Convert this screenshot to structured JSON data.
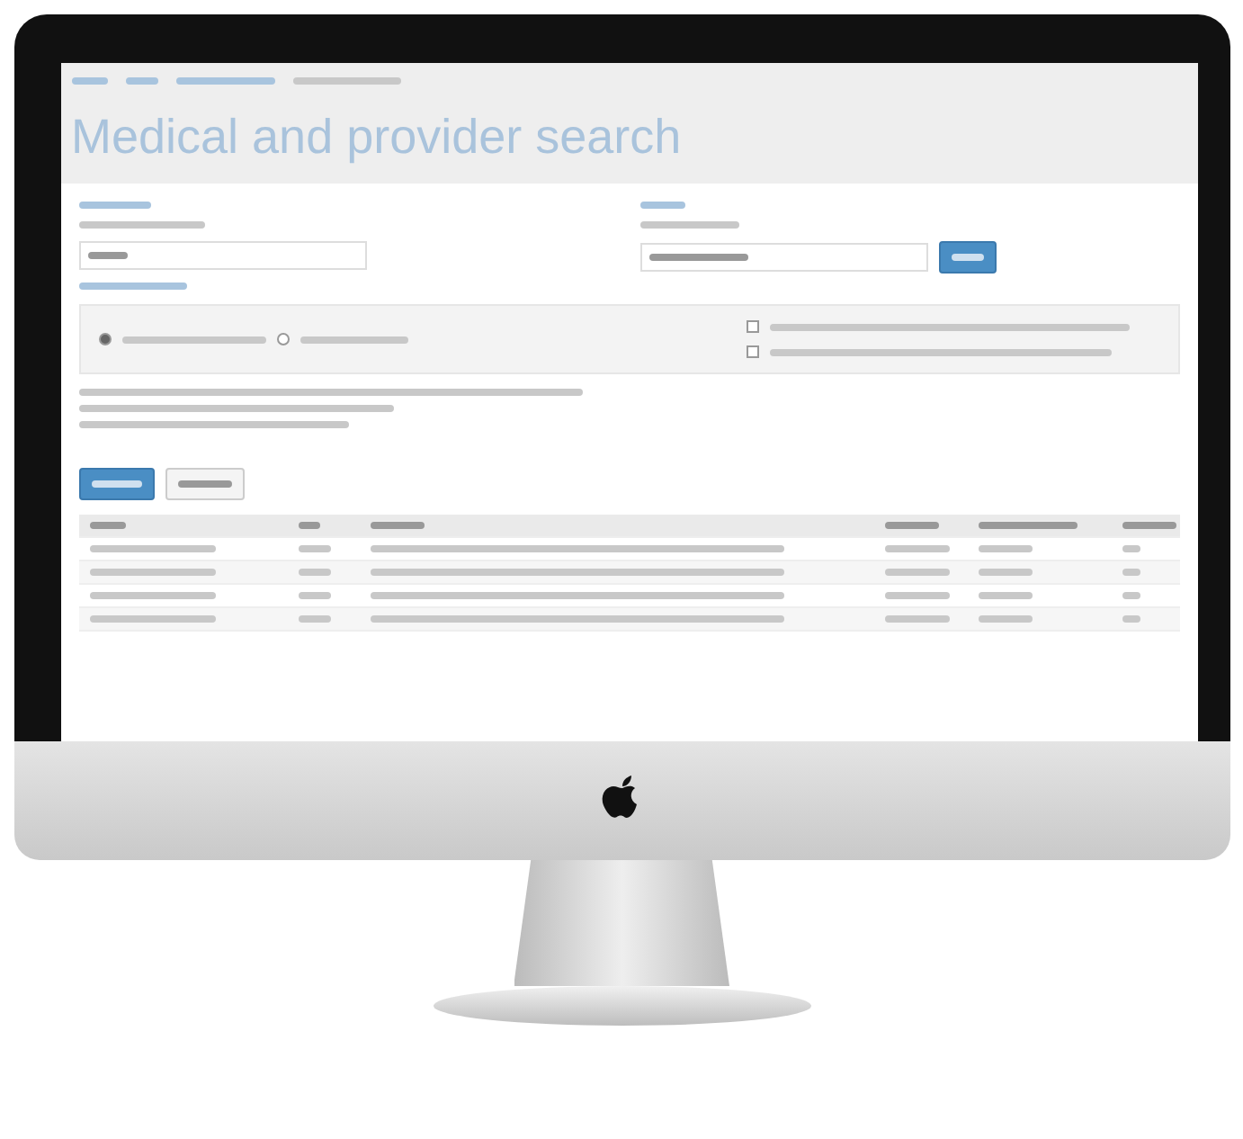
{
  "page": {
    "title": "Medical and provider search"
  },
  "radio_options": [
    {
      "selected": true
    },
    {
      "selected": false
    }
  ],
  "checkboxes": [
    {
      "checked": false
    },
    {
      "checked": false
    }
  ],
  "view_buttons": [
    {
      "selected": true
    },
    {
      "selected": false
    }
  ]
}
